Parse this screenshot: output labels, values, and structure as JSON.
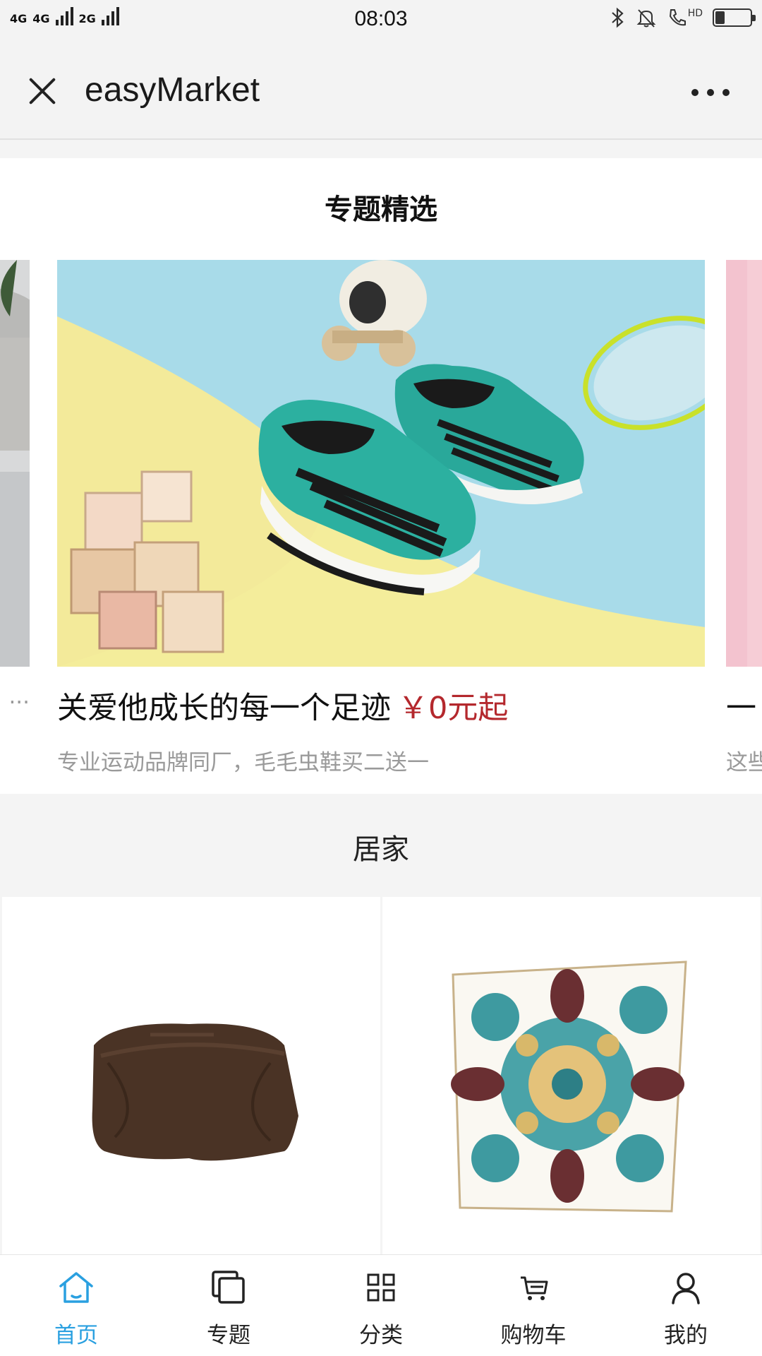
{
  "status_bar": {
    "network_left": "4G",
    "network_mid": "4G",
    "network_right": "2G",
    "time": "08:03",
    "hd": "HD",
    "battery_level": 0.28
  },
  "title_bar": {
    "title": "easyMarket"
  },
  "topic_section": {
    "heading": "专题精选",
    "slides": [
      {
        "title": "",
        "price": "",
        "subtitle": "..."
      },
      {
        "title": "关爱他成长的每一个足迹",
        "price": "￥0元起",
        "subtitle": "专业运动品牌同厂，毛毛虫鞋买二送一"
      },
      {
        "title": "一",
        "price": "",
        "subtitle": "这些"
      }
    ]
  },
  "home_category": {
    "heading": "居家"
  },
  "colors": {
    "accent": "#2aa0e0",
    "price": "#b4282d",
    "shoe": "#29a89a"
  },
  "tab_bar": {
    "items": [
      {
        "label": "首页",
        "icon": "home-icon",
        "active": true
      },
      {
        "label": "专题",
        "icon": "topic-icon",
        "active": false
      },
      {
        "label": "分类",
        "icon": "category-icon",
        "active": false
      },
      {
        "label": "购物车",
        "icon": "cart-icon",
        "active": false
      },
      {
        "label": "我的",
        "icon": "user-icon",
        "active": false
      }
    ]
  }
}
